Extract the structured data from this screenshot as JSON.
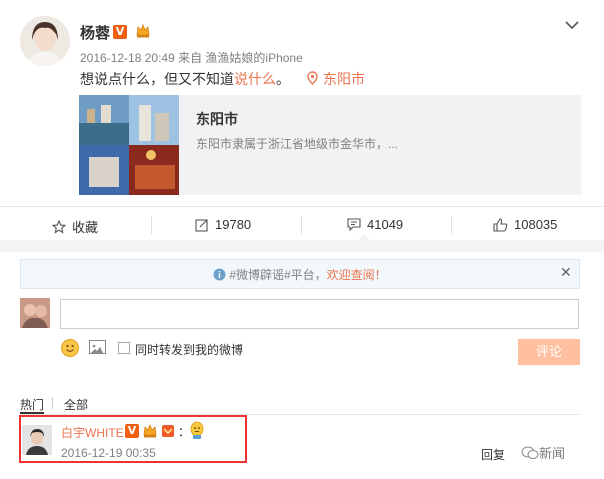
{
  "post": {
    "username": "杨蓉",
    "verified_badge": "V",
    "meta": "2016-12-18 20:49 来自 渔渔姑娘的iPhone",
    "text_plain": "想说点什么，但又不知道",
    "text_highlight": "说什么",
    "text_end": "。",
    "location": "东阳市",
    "card": {
      "title": "东阳市",
      "description": "东阳市隶属于浙江省地级市金华市，..."
    }
  },
  "actions": {
    "favorite_label": "收藏",
    "forward_count": "19780",
    "comment_count": "41049",
    "like_count": "108035"
  },
  "comment_area": {
    "notice_prefix": "#微博辟谣#平台，",
    "notice_highlight": "欢迎查阅！",
    "forward_checkbox_label": "同时转发到我的微博",
    "submit_label": "评论",
    "close_glyph": "✕"
  },
  "tabs": {
    "hot": "热门",
    "all": "全部"
  },
  "comment": {
    "username": "白宇WHITE",
    "verified_badge": "V",
    "colon": "：",
    "time": "2016-12-19 00:35",
    "reply_label": "回复",
    "watermark": "新闻"
  },
  "colors": {
    "accent": "#eb7350",
    "submit_disabled": "#ffc09f",
    "highlight_box": "#e33333"
  },
  "icons": {
    "chevron": "chevron-down-icon",
    "location": "location-pin-icon",
    "favorite": "star-icon",
    "forward": "forward-icon",
    "comment": "comment-icon",
    "like": "thumbs-up-icon",
    "info": "info-icon",
    "emoji": "smiley-icon",
    "image": "image-icon"
  }
}
